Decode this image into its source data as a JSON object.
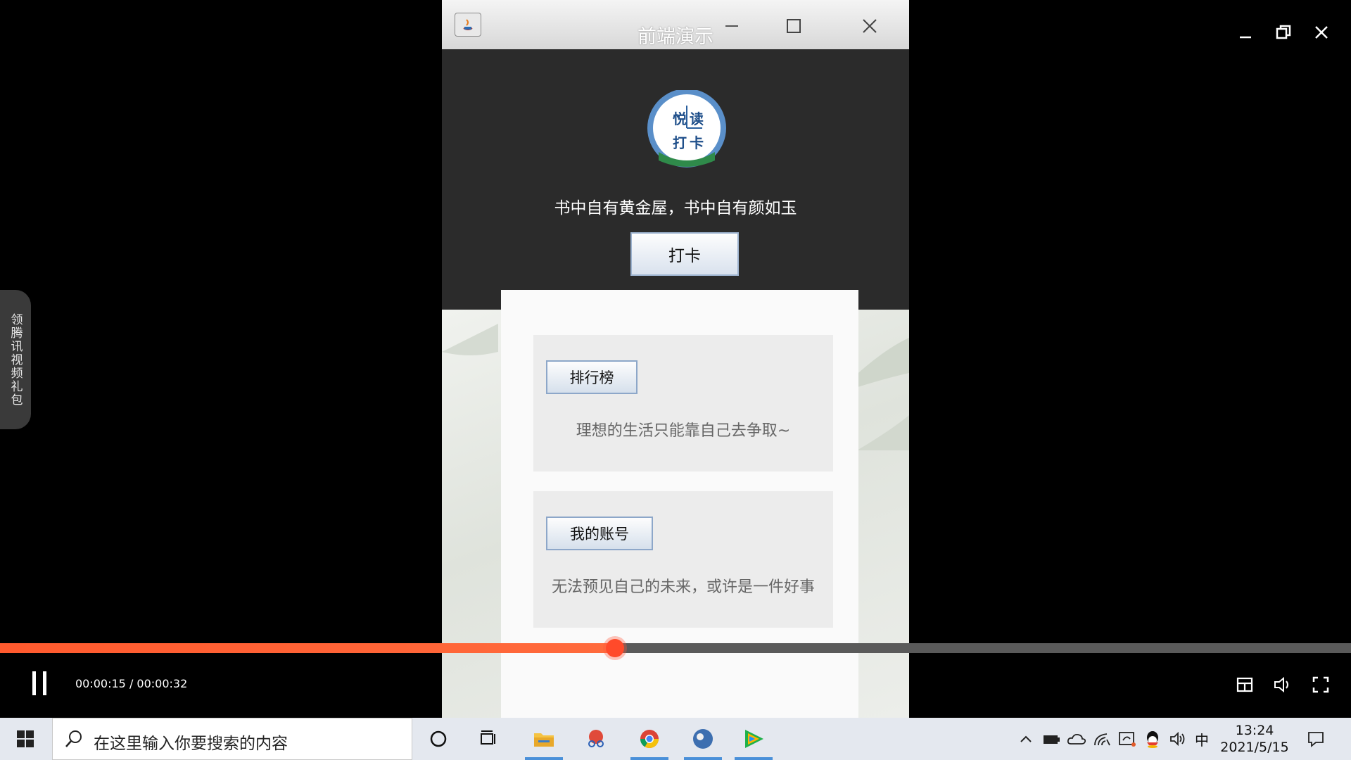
{
  "player": {
    "side_tab_label": "领腾讯视频礼包",
    "current_time": "00:00:15",
    "total_time": "00:00:32",
    "time_separator": " / ",
    "progress": 0.455,
    "accent_color": "#ff5a2e"
  },
  "app": {
    "window_title": "前端演示",
    "logo_text": [
      "悦",
      "读",
      "打",
      "卡"
    ],
    "motto": "书中自有黄金屋，书中自有颜如玉",
    "checkin_label": "打卡",
    "cards": [
      {
        "button_label": "排行榜",
        "text": "理想的生活只能靠自己去争取~"
      },
      {
        "button_label": "我的账号",
        "text": "无法预见自己的未来，或许是一件好事"
      }
    ]
  },
  "taskbar": {
    "search_placeholder": "在这里输入你要搜索的内容",
    "ime_label": "中",
    "time": "13:24",
    "date": "2021/5/15"
  }
}
